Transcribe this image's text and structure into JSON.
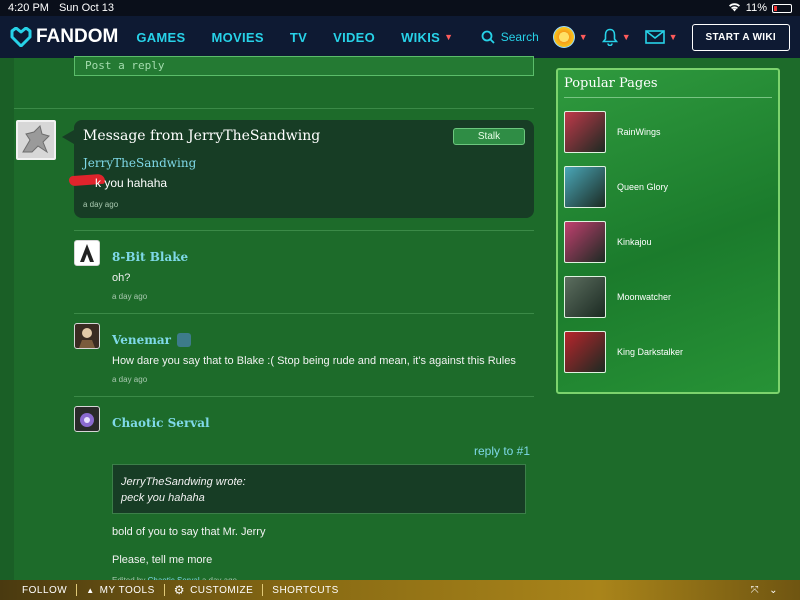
{
  "status_bar": {
    "time": "4:20 PM",
    "date": "Sun Oct 13",
    "battery": "11%"
  },
  "header": {
    "logo_text": "FANDOM",
    "nav": [
      {
        "label": "GAMES"
      },
      {
        "label": "MOVIES"
      },
      {
        "label": "TV"
      },
      {
        "label": "VIDEO"
      },
      {
        "label": "WIKIS"
      }
    ],
    "search_label": "Search",
    "start_wiki_label": "START A WIKI"
  },
  "reply_placeholder": "Post a reply",
  "message": {
    "title": "Message from JerryTheSandwing",
    "stalk_label": "Stalk",
    "author": "JerryTheSandwing",
    "text": "k you hahaha",
    "time": "a day ago"
  },
  "replies": [
    {
      "name": "8-Bit Blake",
      "text": "oh?",
      "time": "a day ago"
    },
    {
      "name": "Venemar",
      "text": "How dare you say that to Blake :( Stop being rude and mean, it's against this Rules",
      "time": "a day ago"
    },
    {
      "name": "Chaotic Serval",
      "reply_to": "reply to #1",
      "quote_author": "JerryTheSandwing wrote:",
      "quote_text": "peck you hahaha",
      "text1": "bold of you to say that Mr. Jerry",
      "text2": "Please, tell me more",
      "edited_prefix": "Edited by",
      "edited_by": "Chaotic Serval",
      "edited_time": "a day ago"
    }
  ],
  "popular_pages": {
    "title": "Popular Pages",
    "items": [
      {
        "label": "RainWings",
        "color": "#c0394a"
      },
      {
        "label": "Queen Glory",
        "color": "#4aa7b8"
      },
      {
        "label": "Kinkajou",
        "color": "#c2406f"
      },
      {
        "label": "Moonwatcher",
        "color": "#5c6e5f"
      },
      {
        "label": "King Darkstalker",
        "color": "#b8252c"
      }
    ]
  },
  "bottom_bar": {
    "follow": "FOLLOW",
    "my_tools": "MY TOOLS",
    "customize": "CUSTOMIZE",
    "shortcuts": "SHORTCUTS"
  }
}
